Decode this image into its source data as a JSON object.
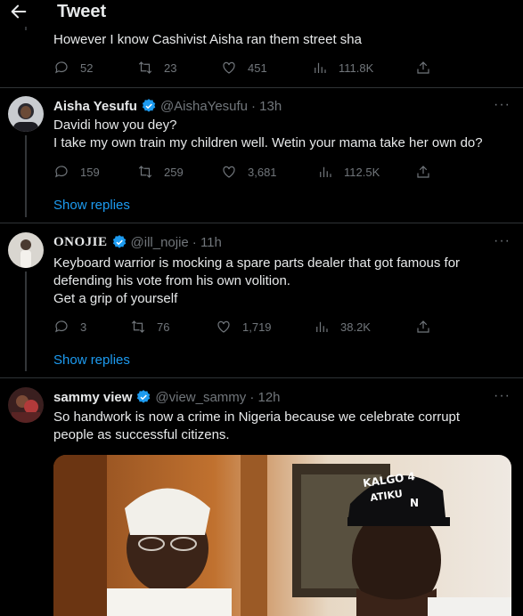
{
  "header": {
    "title": "Tweet",
    "back_icon": "arrow-left-icon"
  },
  "tweets": [
    {
      "text_lines": [
        "However I know Cashivist Aisha ran them street sha"
      ],
      "actions": {
        "replies": "52",
        "retweets": "23",
        "likes": "451",
        "views": "111.8K"
      }
    },
    {
      "name": "Aisha Yesufu",
      "handle": "@AishaYesufu",
      "time": "· 13h",
      "text_lines": [
        "Davidi how you dey?",
        "I take my own train my children well. Wetin your mama take her own do?"
      ],
      "actions": {
        "replies": "159",
        "retweets": "259",
        "likes": "3,681",
        "views": "112.5K"
      },
      "show_replies": "Show replies"
    },
    {
      "name": "ONOJIE",
      "handle": "@ill_nojie",
      "time": "· 11h",
      "text_lines": [
        "Keyboard warrior is mocking a spare parts dealer that got famous for",
        "defending his vote from his own volition.",
        "Get a grip of yourself"
      ],
      "actions": {
        "replies": "3",
        "retweets": "76",
        "likes": "1,719",
        "views": "38.2K"
      },
      "show_replies": "Show replies"
    },
    {
      "name": "sammy view",
      "handle": "@view_sammy",
      "time": "· 12h",
      "text_lines": [
        "So handwork is now a crime in Nigeria because we celebrate corrupt",
        "people as successful citizens."
      ],
      "media": {
        "cap_text_line1": "KALGO 4",
        "cap_text_line2": "ATIKU",
        "cap_letter": "N"
      }
    }
  ],
  "colors": {
    "background": "#000000",
    "text": "#e7e9ea",
    "muted": "#71767b",
    "accent": "#1d9bf0",
    "divider": "#2f3336"
  }
}
